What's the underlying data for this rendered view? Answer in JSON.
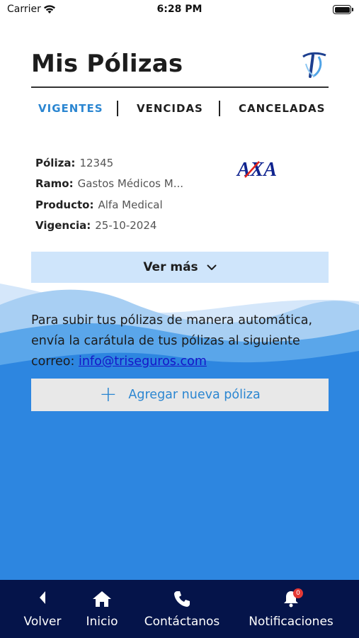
{
  "status_bar": {
    "carrier": "Carrier",
    "time": "6:28 PM"
  },
  "header": {
    "title": "Mis Pólizas"
  },
  "tabs": [
    {
      "label": "VIGENTES",
      "active": true
    },
    {
      "label": "VENCIDAS",
      "active": false
    },
    {
      "label": "CANCELADAS",
      "active": false
    }
  ],
  "policy": {
    "poliza_label": "Póliza:",
    "poliza": "12345",
    "ramo_label": "Ramo:",
    "ramo": "Gastos Médicos M...",
    "producto_label": "Producto:",
    "producto": "Alfa Medical",
    "vigencia_label": "Vigencia:",
    "vigencia": "25-10-2024",
    "insurer_logo": "AXA",
    "ver_mas_label": "Ver más"
  },
  "info": {
    "text": "Para subir tus pólizas de manera automática, envía la carátula de tus pólizas al siguiente correo: ",
    "email": "info@triseguros.com"
  },
  "add_button": {
    "label": "Agregar nueva póliza"
  },
  "bottom_nav": {
    "items": [
      {
        "label": "Volver",
        "icon": "back-arrow-icon"
      },
      {
        "label": "Inicio",
        "icon": "home-icon"
      },
      {
        "label": "Contáctanos",
        "icon": "phone-icon"
      },
      {
        "label": "Notificaciones",
        "icon": "bell-icon"
      }
    ],
    "notification_count": "0"
  },
  "colors": {
    "accent": "#2b86d1",
    "nav_bg": "#05144a",
    "ver_mas_bg": "#cfe5fb",
    "wave_dark": "#2d86e0",
    "link": "#1515c8"
  }
}
